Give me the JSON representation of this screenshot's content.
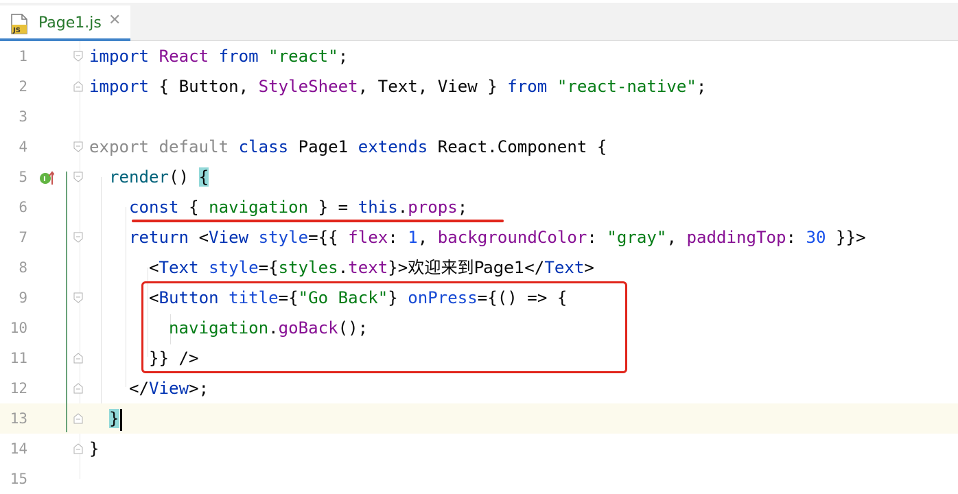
{
  "tab": {
    "title": "Page1.js",
    "icon": "js-file-icon",
    "close_icon": "close-icon",
    "icon_label": "JS"
  },
  "editor": {
    "current_line": 13,
    "line_numbers": [
      "1",
      "2",
      "3",
      "4",
      "5",
      "6",
      "7",
      "8",
      "9",
      "10",
      "11",
      "12",
      "13",
      "14",
      "15"
    ],
    "lines": [
      "import React from \"react\";",
      "import { Button, StyleSheet, Text, View } from \"react-native\";",
      "",
      "export default class Page1 extends React.Component {",
      "  render() {",
      "    const { navigation } = this.props;",
      "    return <View style={{ flex: 1, backgroundColor: \"gray\", paddingTop: 30 }}>",
      "      <Text style={styles.text}>欢迎来到Page1</Text>",
      "      <Button title={\"Go Back\"} onPress={() => {",
      "        navigation.goBack();",
      "      }} />",
      "    </View>;",
      "  }",
      "}",
      ""
    ]
  },
  "colors": {
    "keyword": "#0033b3",
    "identifier": "#871094",
    "string": "#067d17",
    "number": "#1750eb",
    "highlight_box": "#e1261c",
    "current_line_bg": "#fcfaed",
    "brace_match": "#93d9d9"
  }
}
